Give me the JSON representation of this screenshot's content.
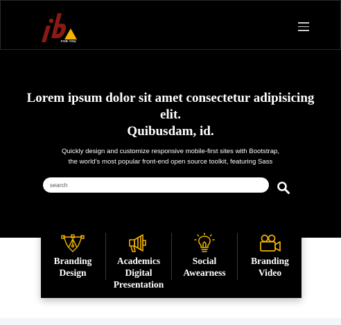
{
  "navbar": {
    "logo_letters": "ib",
    "logo_tag": "FOR YOU",
    "menu_icon": "hamburger-icon",
    "colors": {
      "background": "#000000",
      "logo_red": "#8b1a12",
      "logo_yellow": "#f5b400"
    }
  },
  "hero": {
    "title_line1": "Lorem ipsum dolor sit amet consectetur adipisicing",
    "title_line2": "elit.",
    "title_line3": "Quibusdam, id.",
    "subtitle_line1": "Quickly design and customize responsive mobile-first sites with Bootstrap,",
    "subtitle_line2": "the world’s most popular front-end open source toolkit, featuring Sass",
    "search": {
      "placeholder": "search",
      "button_icon": "search-icon"
    }
  },
  "services": {
    "accent": "#f5b400",
    "items": [
      {
        "icon": "pen-tool-icon",
        "line1": "Branding",
        "line2": "Design"
      },
      {
        "icon": "megaphone-icon",
        "line1": "Academics",
        "line2": "Digital",
        "line3": "Presentation"
      },
      {
        "icon": "lightbulb-icon",
        "line1": "Social",
        "line2": "Awearness"
      },
      {
        "icon": "video-camera-icon",
        "line1": "Branding",
        "line2": "Video"
      }
    ]
  }
}
